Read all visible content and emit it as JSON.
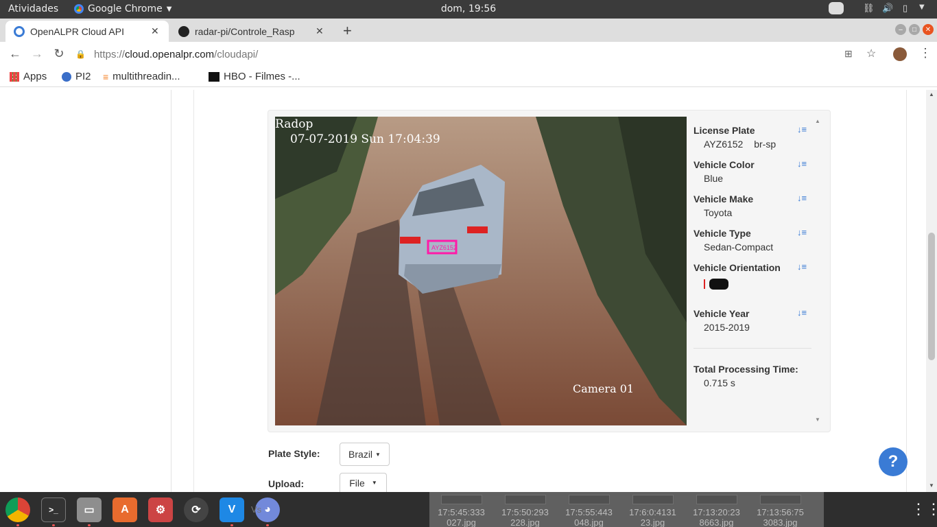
{
  "system": {
    "activities": "Atividades",
    "app_name": "Google Chrome",
    "clock": "dom, 19:56"
  },
  "tabs": [
    {
      "title": "OpenALPR Cloud API"
    },
    {
      "title": "radar-pi/Controle_Rasp"
    }
  ],
  "address": {
    "url_prefix": "https://",
    "url_domain": "cloud.openalpr.com",
    "url_path": "/cloudapi/"
  },
  "bookmarks": [
    {
      "label": "Apps"
    },
    {
      "label": "PI2"
    },
    {
      "label": "multithreadin..."
    },
    {
      "label": "HBO - Filmes -..."
    }
  ],
  "image": {
    "overlay_top_left": "Radop",
    "overlay_datetime": "07-07-2019 Sun 17:04:39",
    "overlay_camera": "Camera 01",
    "plate_text": "AYZ6152"
  },
  "results": {
    "license_plate_label": "License Plate",
    "license_plate_value": "AYZ6152",
    "license_plate_region": "br-sp",
    "color_label": "Vehicle Color",
    "color_value": "Blue",
    "make_label": "Vehicle Make",
    "make_value": "Toyota",
    "type_label": "Vehicle Type",
    "type_value": "Sedan-Compact",
    "orientation_label": "Vehicle Orientation",
    "year_label": "Vehicle Year",
    "year_value": "2015-2019",
    "processing_label": "Total Processing Time:",
    "processing_value": "0.715 s"
  },
  "form": {
    "plate_style_label": "Plate Style:",
    "plate_style_value": "Brazil",
    "upload_label": "Upload:",
    "upload_value": "File"
  },
  "help": "?",
  "thumbnails": [
    {
      "line1": "17:5:45:333",
      "line2": "027.jpg"
    },
    {
      "line1": "17:5:50:293",
      "line2": "228.jpg"
    },
    {
      "line1": "17:5:55:443",
      "line2": "048.jpg"
    },
    {
      "line1": "17:6:0:4131",
      "line2": "23.jpg"
    },
    {
      "line1": "17:13:20:23",
      "line2": "8663.jpg"
    },
    {
      "line1": "17:13:56:75",
      "line2": "3083.jpg"
    }
  ],
  "dock_tooltip": "Vs",
  "colors": {
    "accent": "#3a7bd5",
    "plate_box": "#ff1aa8"
  }
}
